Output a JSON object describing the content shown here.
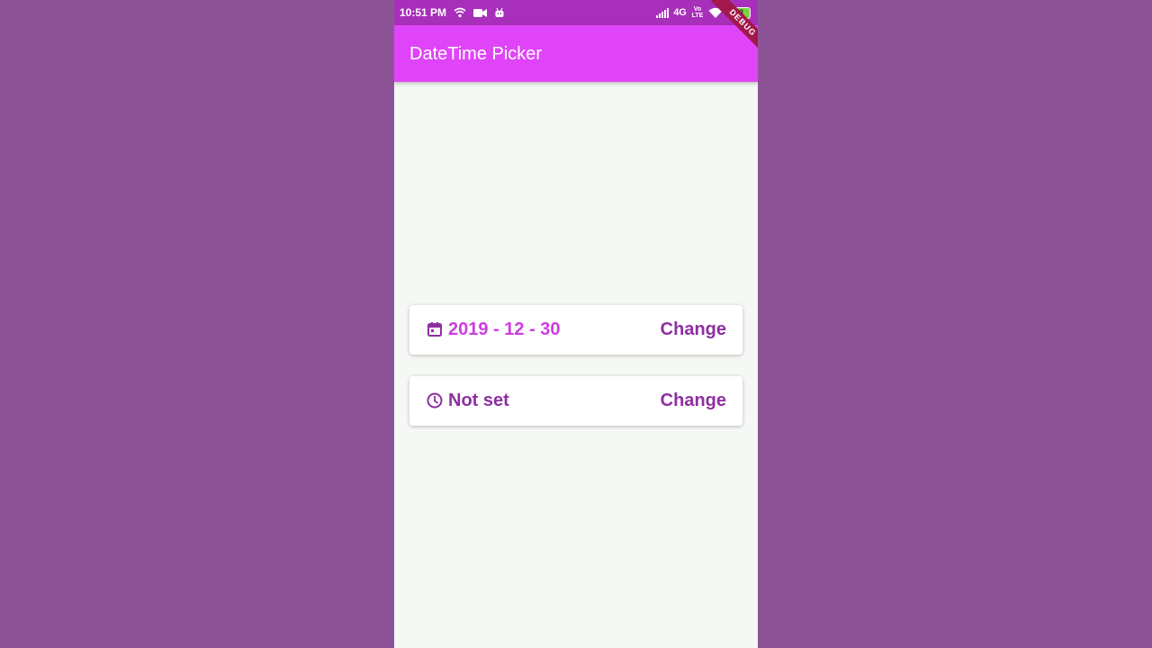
{
  "status_bar": {
    "time": "10:51 PM",
    "network": "4G",
    "volte": "Vo LTE",
    "battery": "78",
    "icons": [
      "wifi-calling-icon",
      "video-camera-icon",
      "android-icon",
      "signal-icon",
      "wifi-icon",
      "battery-icon"
    ]
  },
  "app_bar": {
    "title": "DateTime Picker",
    "debug_banner": "DEBUG"
  },
  "date_card": {
    "icon": "calendar-icon",
    "value": "2019 - 12 - 30",
    "button_label": "Change"
  },
  "time_card": {
    "icon": "clock-icon",
    "value": "Not set",
    "button_label": "Change"
  },
  "colors": {
    "backdrop": "#8c5496",
    "status_bar": "#a72fba",
    "app_bar": "#e044f8",
    "date_value": "#cc3ee0",
    "time_value": "#8e2fa0",
    "button": "#8e2fa0",
    "body": "#f5f8f4",
    "debug_ribbon": "#a2184a"
  }
}
